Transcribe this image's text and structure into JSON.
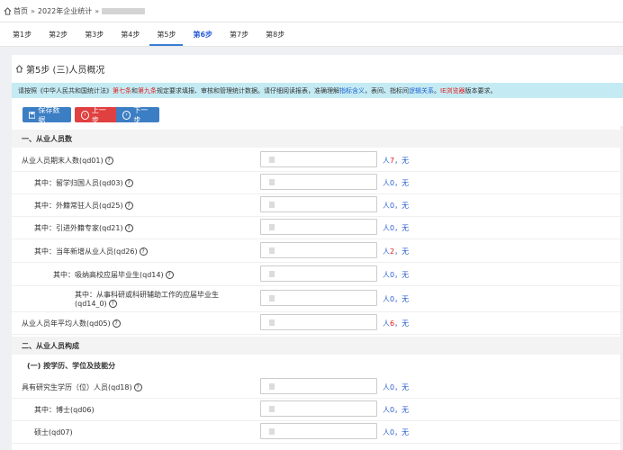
{
  "breadcrumb": {
    "home": "首页",
    "sep": "»",
    "item": "2022年企业统计",
    "sep2": "»"
  },
  "steps": [
    "第1步",
    "第2步",
    "第3步",
    "第4步",
    "第5步",
    "第6步",
    "第7步",
    "第8步"
  ],
  "active_step": 4,
  "title": "第5步 (三)人员概况",
  "notice": {
    "p1": "请按照《中华人民共和国统计法》",
    "p2": "第七条",
    "p3": " 和 ",
    "p4": "第九条",
    "p5": " 规定要求填报、审核和管理统计数据。请仔细阅读报表，准确理解",
    "p6": "指标含义",
    "p7": "，表间、指标间",
    "p8": "逻辑关系",
    "p9": "。",
    "p10": "IE浏览器",
    "p11": "版本要求",
    "p12": "。"
  },
  "toolbar": {
    "save": "保存数据",
    "prev": "上一步",
    "next": "下一步"
  },
  "section1": "一、从业人员数",
  "section2": "二、从业人员构成",
  "subsection": "(一) 按学历、学位及技能分",
  "fields": [
    {
      "label": "从业人员期末人数(qd01)",
      "unit": "人",
      "val": "7",
      "tail": "无"
    },
    {
      "label": "其中：留学归国人员(qd03)",
      "unit": "人",
      "val": "0",
      "tail": "无"
    },
    {
      "label": "其中：外籍常驻人员(qd25)",
      "unit": "人",
      "val": "0",
      "tail": "无"
    },
    {
      "label": "其中：引进外籍专家(qd21)",
      "unit": "人",
      "val": "0",
      "tail": "无"
    },
    {
      "label": "其中：当年新增从业人员(qd26)",
      "unit": "人",
      "val": "2",
      "tail": "无"
    },
    {
      "label": "其中：吸纳高校应届毕业生(qd14)",
      "unit": "人",
      "val": "0",
      "tail": "无"
    },
    {
      "label": "其中：从事科研或科研辅助工作的应届毕业生",
      "label2": "(qd14_0)",
      "unit": "人",
      "val": "0",
      "tail": "无"
    },
    {
      "label": "从业人员年平均人数(qd05)",
      "unit": "人",
      "val": "6",
      "tail": "无"
    },
    {
      "label": "具有研究生学历（位）人员(qd18)",
      "unit": "人",
      "val": "0",
      "tail": "无"
    },
    {
      "label": "其中：博士(qd06)",
      "unit": "人",
      "val": "0",
      "tail": "无"
    },
    {
      "label": "硕士(qd07)",
      "unit": "人",
      "val": "0",
      "tail": "无"
    }
  ],
  "icons": {
    "home": "home-icon",
    "help": "question-circle-icon",
    "save": "save-icon",
    "prev": "arrow-left-circle-icon",
    "next": "arrow-right-circle-icon"
  },
  "colors": {
    "accent": "#3c7ec4",
    "danger": "#e04040",
    "notice_bg": "#c4ebf4",
    "link_blue": "#2d5fd1"
  }
}
